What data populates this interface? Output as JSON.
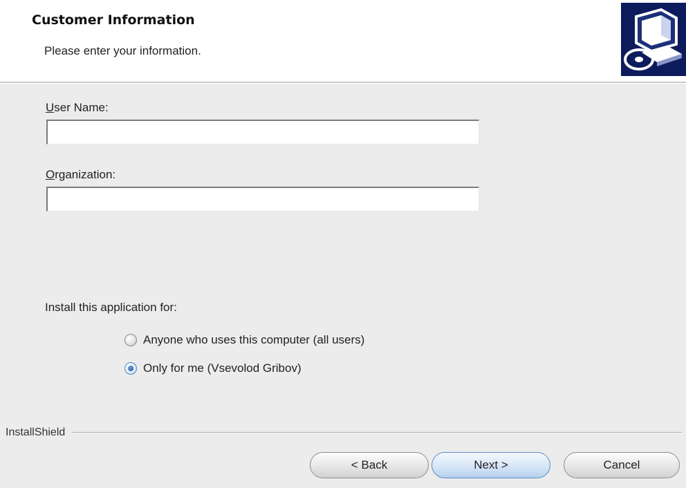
{
  "header": {
    "title": "Customer Information",
    "subtitle": "Please enter your information.",
    "logo_icon": "installer-computer-icon"
  },
  "form": {
    "user_name": {
      "label_mnemonic": "U",
      "label_rest": "ser Name:",
      "value": ""
    },
    "organization": {
      "label_mnemonic": "O",
      "label_rest": "rganization:",
      "value": ""
    },
    "install_for": {
      "label": "Install this application for:",
      "options": [
        {
          "label": "Anyone who uses this computer (all users)",
          "selected": false
        },
        {
          "label": "Only for me (Vsevolod Gribov)",
          "selected": true
        }
      ]
    }
  },
  "footer": {
    "brand": "InstallShield",
    "buttons": {
      "back": "< Back",
      "next": "Next >",
      "cancel": "Cancel"
    }
  },
  "colors": {
    "header_bg": "#ffffff",
    "body_bg": "#ececec",
    "accent": "#4f86c4",
    "logo_dark": "#0c1b5c"
  }
}
